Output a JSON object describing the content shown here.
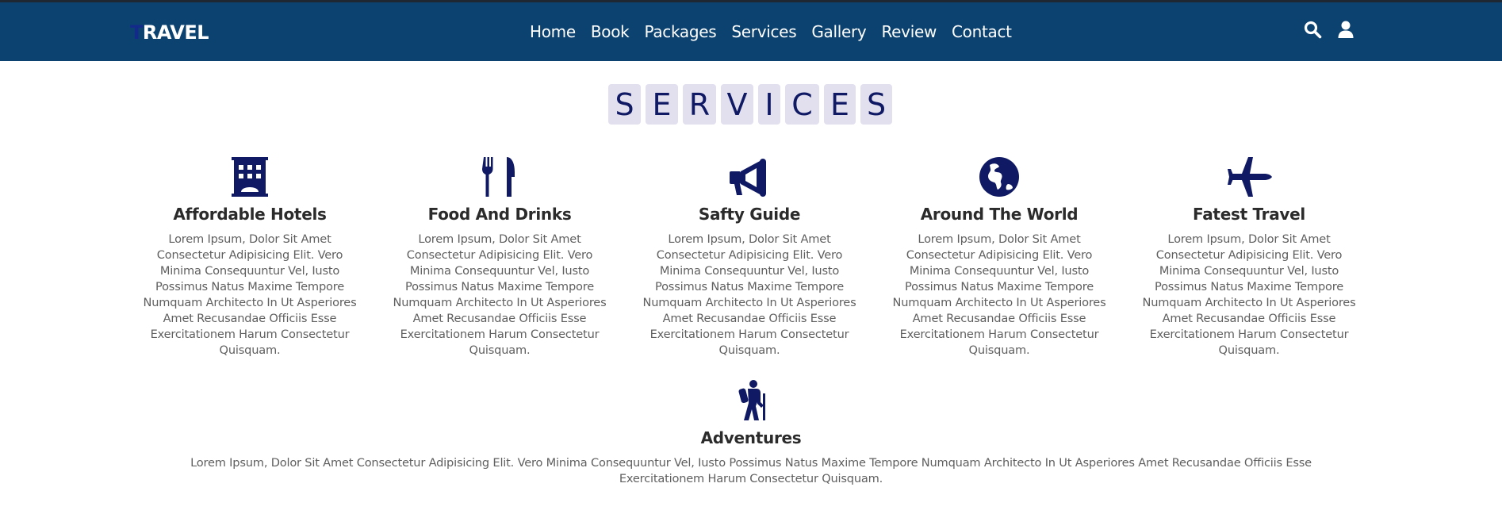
{
  "header": {
    "logo_first": "T",
    "logo_rest": "RAVEL",
    "nav": [
      "Home",
      "Book",
      "Packages",
      "Services",
      "Gallery",
      "Review",
      "Contact"
    ],
    "icons": [
      "search-icon",
      "user-icon"
    ]
  },
  "section": {
    "title_letters": [
      "S",
      "E",
      "R",
      "V",
      "I",
      "C",
      "E",
      "S"
    ]
  },
  "services": [
    {
      "icon": "hotel-icon",
      "title": "Affordable Hotels",
      "text": "Lorem Ipsum, Dolor Sit Amet Consectetur Adipisicing Elit. Vero Minima Consequuntur Vel, Iusto Possimus Natus Maxime Tempore Numquam Architecto In Ut Asperiores Amet Recusandae Officiis Esse Exercitationem Harum Consectetur Quisquam."
    },
    {
      "icon": "utensils-icon",
      "title": "Food And Drinks",
      "text": "Lorem Ipsum, Dolor Sit Amet Consectetur Adipisicing Elit. Vero Minima Consequuntur Vel, Iusto Possimus Natus Maxime Tempore Numquam Architecto In Ut Asperiores Amet Recusandae Officiis Esse Exercitationem Harum Consectetur Quisquam."
    },
    {
      "icon": "bullhorn-icon",
      "title": "Safty Guide",
      "text": "Lorem Ipsum, Dolor Sit Amet Consectetur Adipisicing Elit. Vero Minima Consequuntur Vel, Iusto Possimus Natus Maxime Tempore Numquam Architecto In Ut Asperiores Amet Recusandae Officiis Esse Exercitationem Harum Consectetur Quisquam."
    },
    {
      "icon": "globe-icon",
      "title": "Around The World",
      "text": "Lorem Ipsum, Dolor Sit Amet Consectetur Adipisicing Elit. Vero Minima Consequuntur Vel, Iusto Possimus Natus Maxime Tempore Numquam Architecto In Ut Asperiores Amet Recusandae Officiis Esse Exercitationem Harum Consectetur Quisquam."
    },
    {
      "icon": "plane-icon",
      "title": "Fatest Travel",
      "text": "Lorem Ipsum, Dolor Sit Amet Consectetur Adipisicing Elit. Vero Minima Consequuntur Vel, Iusto Possimus Natus Maxime Tempore Numquam Architecto In Ut Asperiores Amet Recusandae Officiis Esse Exercitationem Harum Consectetur Quisquam."
    },
    {
      "icon": "hiking-icon",
      "title": "Adventures",
      "text": "Lorem Ipsum, Dolor Sit Amet Consectetur Adipisicing Elit. Vero Minima Consequuntur Vel, Iusto Possimus Natus Maxime Tempore Numquam Architecto In Ut Asperiores Amet Recusandae Officiis Esse Exercitationem Harum Consectetur Quisquam."
    }
  ],
  "colors": {
    "header_bg": "#0c4270",
    "logo_accent": "#142a8a",
    "icon_color": "#101a64",
    "letter_tile_bg": "#e2e0ee",
    "title_text": "#2b2b2b",
    "body_text": "#5f5f5f"
  }
}
